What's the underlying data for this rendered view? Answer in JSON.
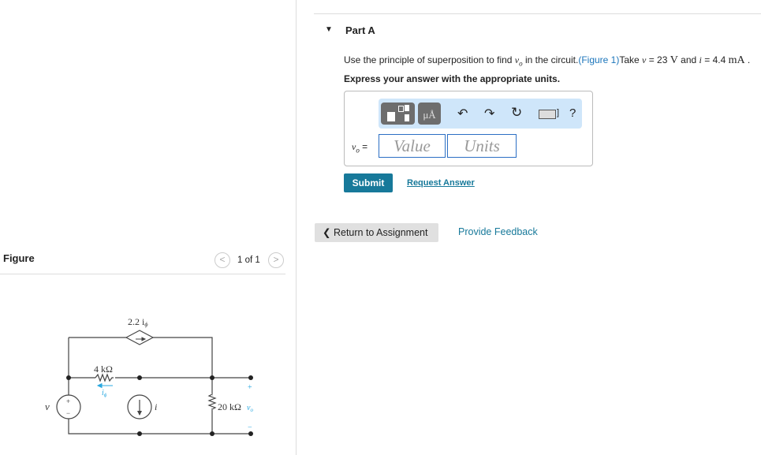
{
  "part": {
    "title": "Part A"
  },
  "question": {
    "text_pre": "Use the principle of superposition to find ",
    "var_vo": "v",
    "sub_o": "o",
    "text_mid": " in the circuit.",
    "figure_link": "(Figure 1)",
    "text_take": "Take ",
    "var_v": "v",
    "eq1": " = 23 ",
    "unit_v": "V",
    "and": " and ",
    "var_i": "i",
    "eq2": " = 4.4 ",
    "unit_ma": "mA",
    "end": " ."
  },
  "instruction": "Express your answer with the appropriate units.",
  "answer": {
    "label": "v",
    "label_sub": "o",
    "equals": "=",
    "value_placeholder": "Value",
    "units_placeholder": "Units",
    "units_btn": "μÅ",
    "help": "?"
  },
  "submit_label": "Submit",
  "request_answer_label": "Request Answer",
  "return_label": "Return to Assignment",
  "feedback_label": "Provide Feedback",
  "figure": {
    "title": "Figure",
    "pager": "1 of 1"
  },
  "circuit": {
    "dep_source": "2.2 i",
    "dep_sub": "ϕ",
    "r1": "4 kΩ",
    "i_phi": "i",
    "i_phi_sub": "ϕ",
    "v": "v",
    "i": "i",
    "r2": "20 kΩ",
    "vo": "v",
    "vo_sub": "o",
    "plus": "+",
    "minus": "−"
  }
}
